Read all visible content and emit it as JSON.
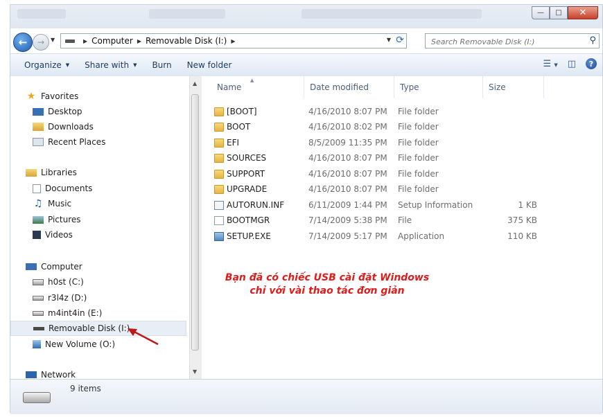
{
  "window": {
    "breadcrumb": [
      "Computer",
      "Removable Disk (I:)"
    ],
    "search_placeholder": "Search Removable Disk (I:)"
  },
  "toolbar": {
    "organize": "Organize",
    "share_with": "Share with",
    "burn": "Burn",
    "new_folder": "New folder"
  },
  "nav": {
    "favorites": "Favorites",
    "desktop": "Desktop",
    "downloads": "Downloads",
    "recent": "Recent Places",
    "libraries": "Libraries",
    "documents": "Documents",
    "music": "Music",
    "pictures": "Pictures",
    "videos": "Videos",
    "computer": "Computer",
    "drive_c": "h0st (C:)",
    "drive_d": "r3l4z (D:)",
    "drive_e": "m4int4in (E:)",
    "drive_i": "Removable Disk (I:)",
    "drive_o": "New Volume (O:)",
    "network": "Network"
  },
  "columns": {
    "name": "Name",
    "date": "Date modified",
    "type": "Type",
    "size": "Size"
  },
  "files": [
    {
      "name": "[BOOT]",
      "date": "4/16/2010 8:07 PM",
      "type": "File folder",
      "size": ""
    },
    {
      "name": "BOOT",
      "date": "4/16/2010 8:02 PM",
      "type": "File folder",
      "size": ""
    },
    {
      "name": "EFI",
      "date": "8/5/2009 11:35 PM",
      "type": "File folder",
      "size": ""
    },
    {
      "name": "SOURCES",
      "date": "4/16/2010 8:07 PM",
      "type": "File folder",
      "size": ""
    },
    {
      "name": "SUPPORT",
      "date": "4/16/2010 8:07 PM",
      "type": "File folder",
      "size": ""
    },
    {
      "name": "UPGRADE",
      "date": "4/16/2010 8:07 PM",
      "type": "File folder",
      "size": ""
    },
    {
      "name": "AUTORUN.INF",
      "date": "6/11/2009 1:44 PM",
      "type": "Setup Information",
      "size": "1 KB"
    },
    {
      "name": "BOOTMGR",
      "date": "7/14/2009 5:38 PM",
      "type": "File",
      "size": "375 KB"
    },
    {
      "name": "SETUP.EXE",
      "date": "7/14/2009 5:17 PM",
      "type": "Application",
      "size": "110 KB"
    }
  ],
  "annotation": {
    "line1": "Bạn đã có chiếc USB cài đặt Windows",
    "line2": "chỉ với vài thao tác đơn giản",
    "color": "#e01b1b"
  },
  "status": {
    "items": "9 items"
  }
}
